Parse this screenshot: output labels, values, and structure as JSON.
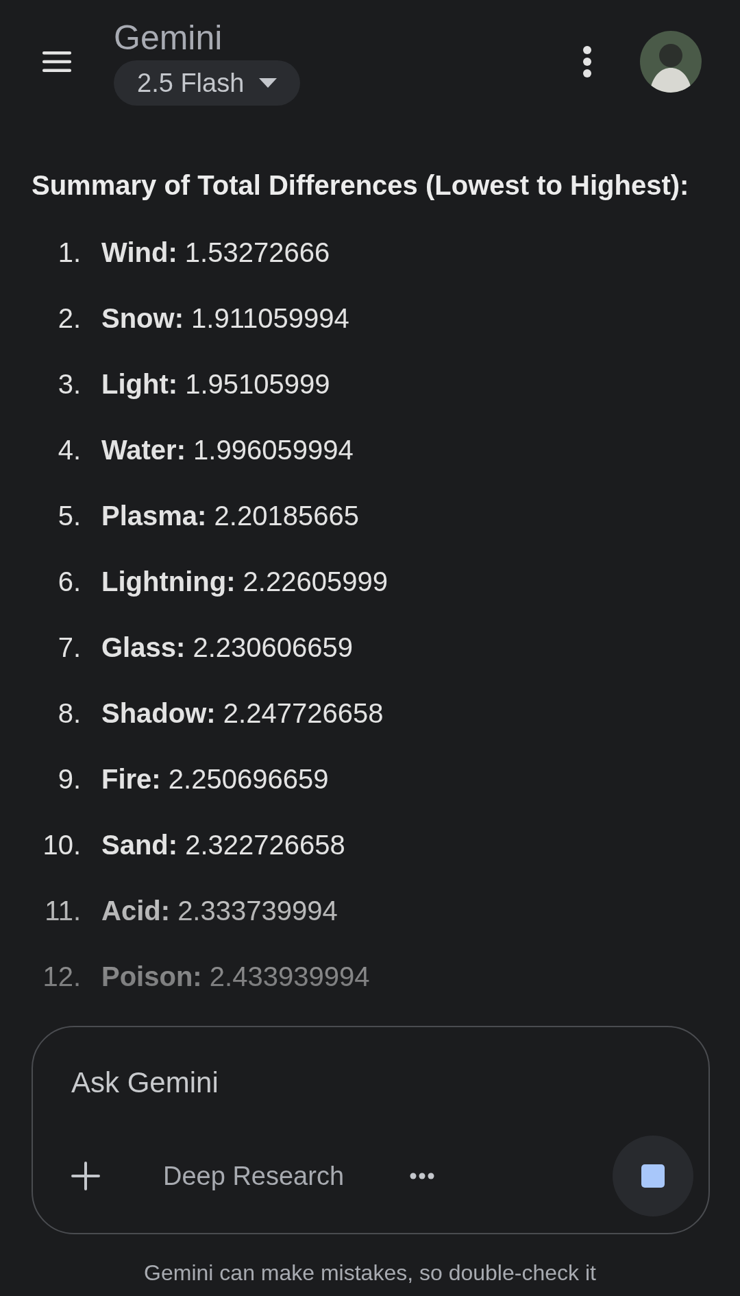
{
  "header": {
    "title": "Gemini",
    "model": "2.5 Flash"
  },
  "heading": "Summary of Total Differences (Lowest to Highest):",
  "items": [
    {
      "number": "1.",
      "label": "Wind:",
      "value": "1.53272666"
    },
    {
      "number": "2.",
      "label": "Snow:",
      "value": "1.911059994"
    },
    {
      "number": "3.",
      "label": "Light:",
      "value": "1.95105999"
    },
    {
      "number": "4.",
      "label": "Water:",
      "value": "1.996059994"
    },
    {
      "number": "5.",
      "label": "Plasma:",
      "value": "2.20185665"
    },
    {
      "number": "6.",
      "label": "Lightning:",
      "value": "2.22605999"
    },
    {
      "number": "7.",
      "label": "Glass:",
      "value": "2.230606659"
    },
    {
      "number": "8.",
      "label": "Shadow:",
      "value": "2.247726658"
    },
    {
      "number": "9.",
      "label": "Fire:",
      "value": "2.250696659"
    },
    {
      "number": "10.",
      "label": "Sand:",
      "value": "2.322726658"
    },
    {
      "number": "11.",
      "label": "Acid:",
      "value": "2.333739994"
    },
    {
      "number": "12.",
      "label": "Poison:",
      "value": "2.433939994"
    }
  ],
  "composer": {
    "placeholder": "Ask Gemini",
    "tool": "Deep Research"
  },
  "disclaimer": "Gemini can make mistakes, so double-check it"
}
